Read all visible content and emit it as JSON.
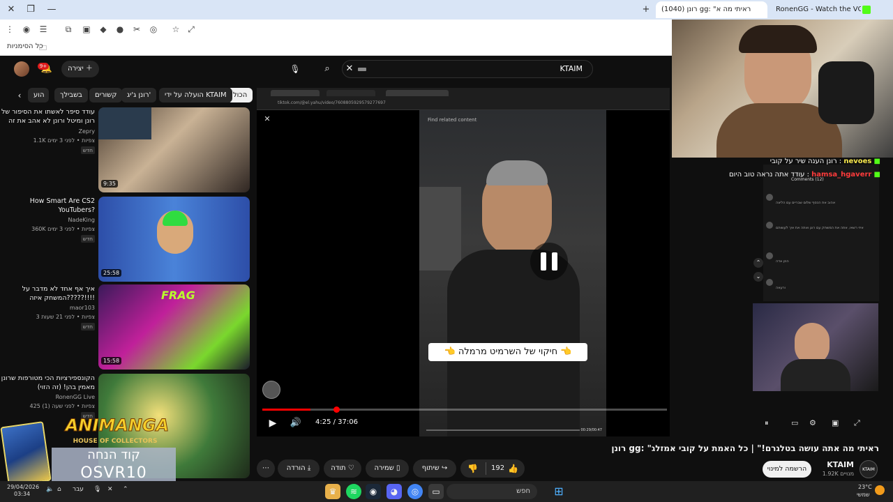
{
  "browser": {
    "tabs": [
      {
        "label": "(1040) רונן gg: \"ראיתי מה א"
      },
      {
        "label": "RonenGG - Watch the VOD on"
      }
    ],
    "bookmarks_label": "כל הסימניות"
  },
  "header": {
    "search_value": "KTAIM",
    "create_label": "יצירה",
    "notif_count": "9+"
  },
  "chips": [
    "הכול",
    "הועלה על ידי KTAIM",
    "רונן ג'יג'",
    "קשורים",
    "בשבילך",
    "הוע"
  ],
  "videos": [
    {
      "title": "עודד סיפר לאשתו את הסיפור של רונן ומיטל ורונן לא אהב את זה",
      "channel": "Zepry",
      "meta": "1.1K צפיות • לפני 3 ימים",
      "badge": "חדש",
      "duration": "9:35"
    },
    {
      "title": "How Smart Are CS2 YouTubers?",
      "channel": "NadeKing",
      "meta": "360K צפיות • לפני 3 ימים",
      "badge": "חדש",
      "duration": "25:58"
    },
    {
      "title": "איך אף אחד לא מדבר על המשחק איזה?????!!!!",
      "channel": "maor103",
      "meta": "3 צפיות • לפני 21 שעות",
      "badge": "חדש",
      "duration": "15:58"
    },
    {
      "title": "הקונספירציות הכי מטורפות שרונן מאמין בהן! (זה הזוי)",
      "channel": "RonenGG Live",
      "meta": "425 צפיות • לפני שעה (1)",
      "badge": "חדש",
      "duration": ""
    }
  ],
  "player": {
    "inner_url": "tiktok.com/@el.yahu/video/7608805929579277697",
    "inner_header": "Find related content",
    "caption": "👈 חיקוי של השרמיט מרמלה 👈",
    "time": "4:25 / 37:06",
    "progress": 0.119,
    "inner_time": "00:29/00:47"
  },
  "chat": [
    {
      "user": "nevoes",
      "color": "#f7e84c",
      "text": "רונן הענה שיר על קובי : "
    },
    {
      "user": "hamsa_hgaverr",
      "color": "#ff3b3b",
      "text": "עודד אתה נראה טוב היום : "
    }
  ],
  "inner_comments": {
    "header": "Comments (12)",
    "items": [
      "אהוב את הכסף שלום שבריים עם הליצה",
      "איזי רשאי, אתה את המשחק עם רונן ואתה את איך לעשותם",
      "הוזן אדה",
      "ורעאה"
    ]
  },
  "video": {
    "title": "רונן gg: \"ראיתי מה אתה עושה בטלגרם!\" | כל האמת על קובי אמזלג",
    "channel": "KTAIM",
    "subs": "1.92K מנויים",
    "subscribe": "הרשמה למינוי",
    "likes": "192",
    "share": "שיתוף",
    "save": "שמירה",
    "thanks": "תודה",
    "download": "הורדה"
  },
  "promo": {
    "title": "ANIMANGA",
    "subtitle": "HOUSE OF COLLECTORS",
    "code_label": "קוד הנחה",
    "code": "OSVR10"
  },
  "taskbar": {
    "search": "חפש",
    "date": "29/04/2026",
    "time": "03:34",
    "lang": "עבר",
    "weather": "23°C",
    "weather_label": "שמשי"
  }
}
